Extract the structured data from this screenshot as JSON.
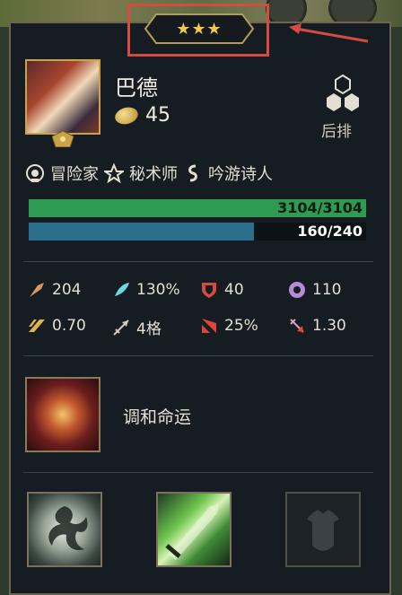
{
  "champion": {
    "name": "巴德",
    "cost": "45",
    "star_level": 3,
    "stars": "★★★",
    "position_label": "后排"
  },
  "traits": [
    {
      "icon": "adventurer-trait-icon",
      "label": "冒险家"
    },
    {
      "icon": "arcanist-trait-icon",
      "label": "秘术师"
    },
    {
      "icon": "bard-trait-icon",
      "label": "吟游诗人"
    }
  ],
  "health": {
    "text": "3104/3104",
    "current": 3104,
    "max": 3104
  },
  "mana": {
    "text": "160/240",
    "current": 160,
    "max": 240
  },
  "stats": {
    "attack_damage": "204",
    "ability_power": "130%",
    "armor": "40",
    "magic_resist": "110",
    "attack_speed": "0.70",
    "range": "4格",
    "crit_chance": "25%",
    "crit_damage": "1.30"
  },
  "ability": {
    "name": "调和命运"
  },
  "items": [
    {
      "icon": "item-swirl-icon",
      "empty": false
    },
    {
      "icon": "item-green-blade-icon",
      "empty": false
    },
    {
      "icon": "empty-item-slot-icon",
      "empty": true
    }
  ],
  "colors": {
    "health_bar": "#2f9a52",
    "mana_bar": "#2c6f8c",
    "highlight": "#d64b3f",
    "star": "#f2c94c",
    "panel_bg": "#161d22"
  }
}
